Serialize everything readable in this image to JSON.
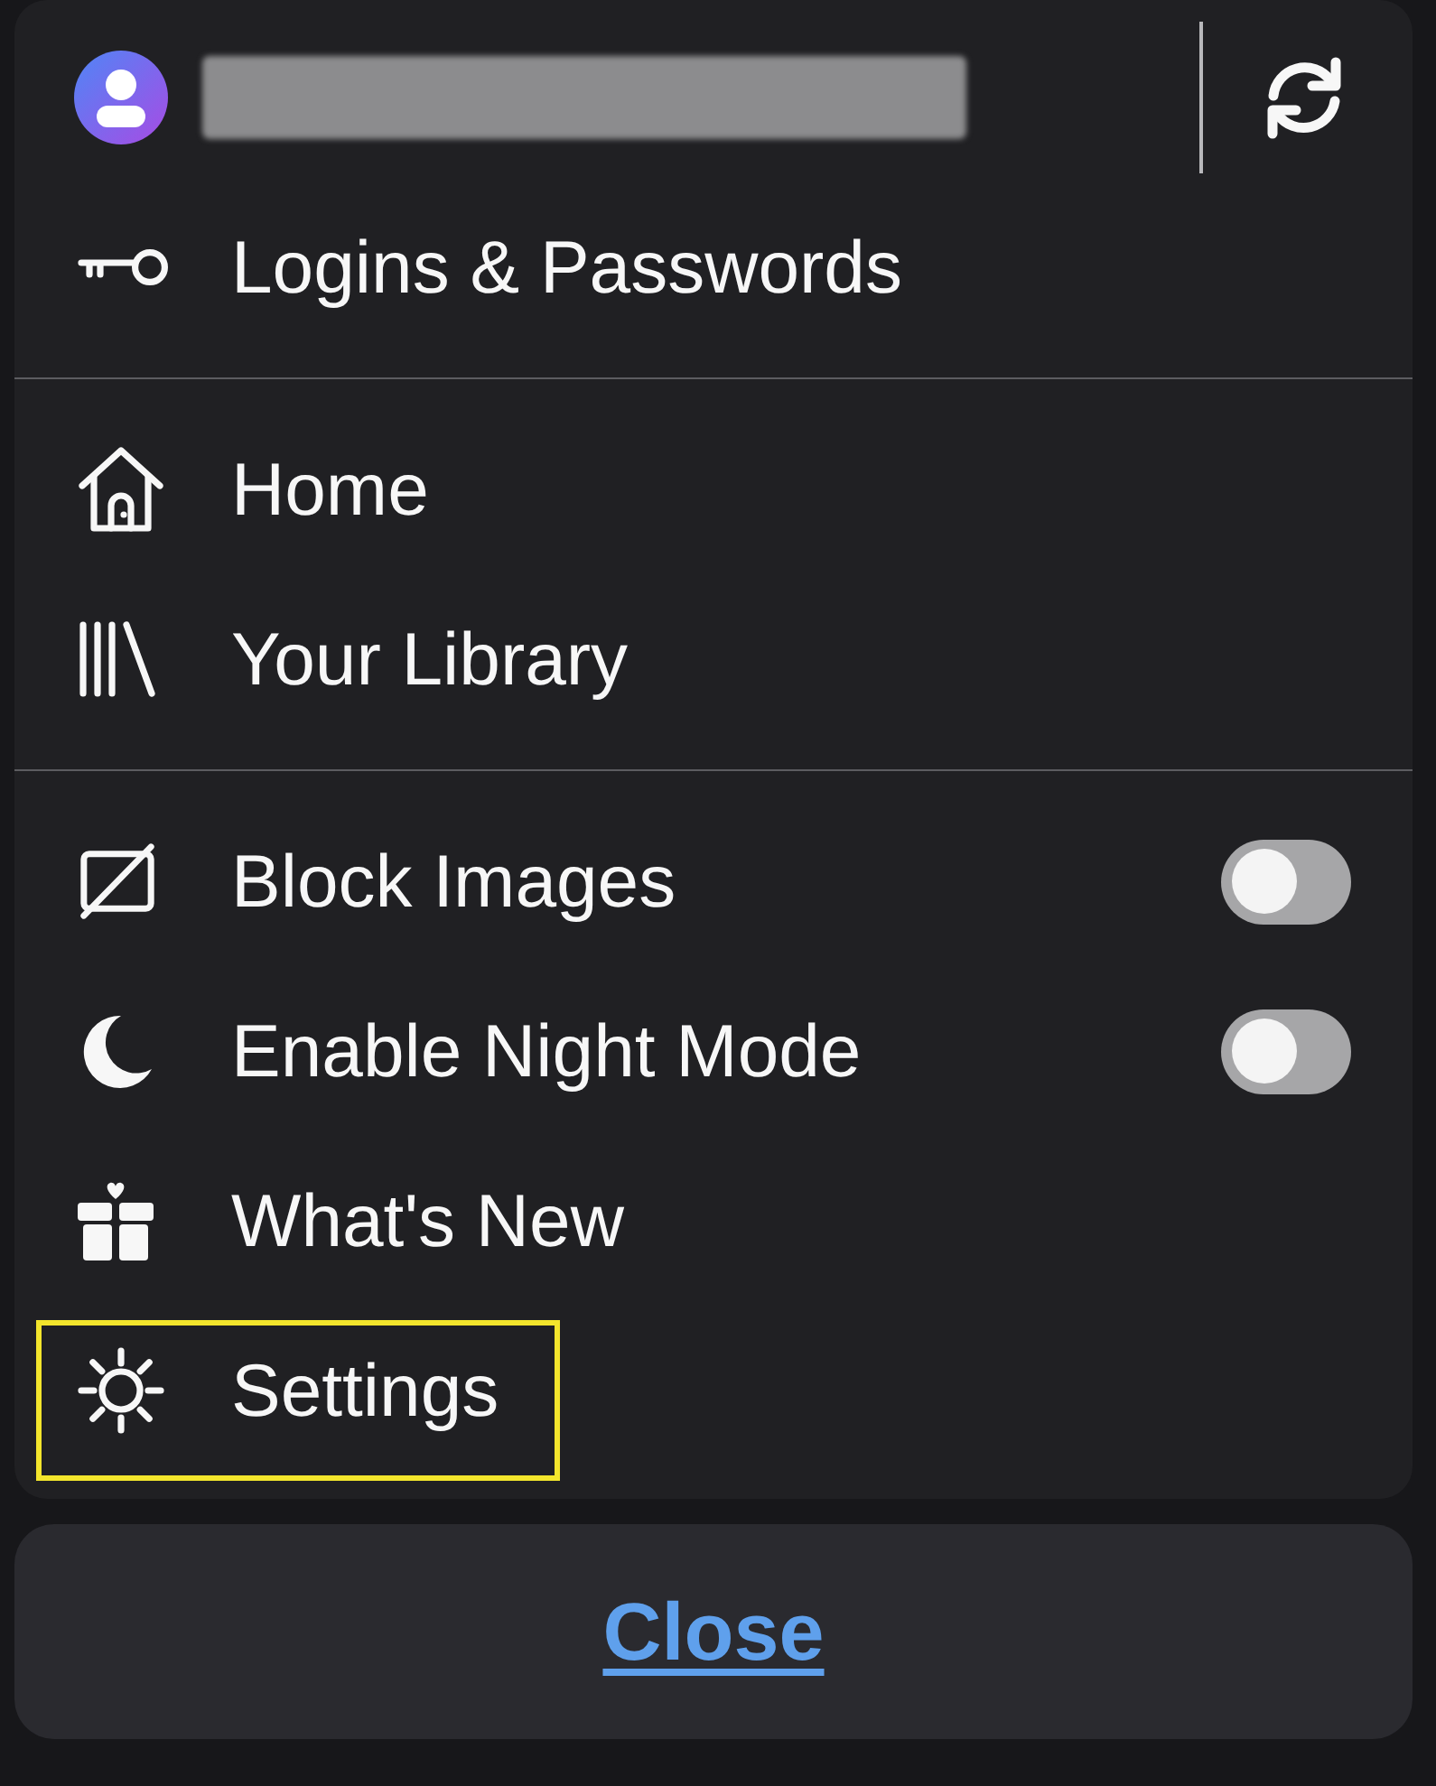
{
  "menu": {
    "sections": [
      {
        "items": [
          {
            "kind": "link",
            "label": "Logins & Passwords",
            "highlighted": false
          }
        ]
      },
      {
        "items": [
          {
            "kind": "link",
            "label": "Home",
            "highlighted": false
          },
          {
            "kind": "link",
            "label": "Your Library",
            "highlighted": false
          }
        ]
      },
      {
        "items": [
          {
            "kind": "toggle",
            "label": "Block Images",
            "on": false,
            "highlighted": false
          },
          {
            "kind": "toggle",
            "label": "Enable Night Mode",
            "on": false,
            "highlighted": false
          },
          {
            "kind": "link",
            "label": "What's New",
            "highlighted": false
          },
          {
            "kind": "link",
            "label": "Settings",
            "highlighted": true
          }
        ]
      }
    ]
  },
  "close_button": {
    "label": "Close"
  }
}
